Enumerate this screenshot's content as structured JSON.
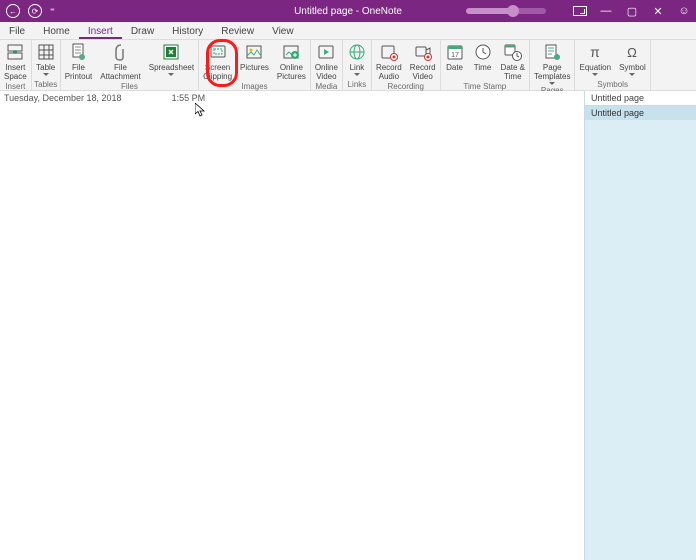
{
  "titlebar": {
    "title": "Untitled page - OneNote"
  },
  "tabs": [
    "File",
    "Home",
    "Insert",
    "Draw",
    "History",
    "Review",
    "View"
  ],
  "active_tab": 2,
  "groups": [
    {
      "label": "Insert",
      "items": [
        {
          "name": "insert-space-button",
          "label": "Insert\nSpace",
          "icon": "insert-space"
        }
      ]
    },
    {
      "label": "Tables",
      "items": [
        {
          "name": "table-button",
          "label": "Table",
          "icon": "table",
          "dd": true
        }
      ]
    },
    {
      "label": "Files",
      "items": [
        {
          "name": "file-printout-button",
          "label": "File\nPrintout",
          "icon": "file-printout"
        },
        {
          "name": "file-attachment-button",
          "label": "File\nAttachment",
          "icon": "file-attachment"
        },
        {
          "name": "spreadsheet-button",
          "label": "Spreadsheet",
          "icon": "spreadsheet",
          "dd": true
        }
      ]
    },
    {
      "label": "Images",
      "items": [
        {
          "name": "screen-clipping-button",
          "label": "Screen\nClipping",
          "icon": "screen-clipping"
        },
        {
          "name": "pictures-button",
          "label": "Pictures",
          "icon": "pictures"
        },
        {
          "name": "online-pictures-button",
          "label": "Online\nPictures",
          "icon": "online-pictures"
        }
      ]
    },
    {
      "label": "Media",
      "items": [
        {
          "name": "online-video-button",
          "label": "Online\nVideo",
          "icon": "online-video"
        }
      ]
    },
    {
      "label": "Links",
      "items": [
        {
          "name": "link-button",
          "label": "Link",
          "icon": "link",
          "dd": true
        }
      ]
    },
    {
      "label": "Recording",
      "items": [
        {
          "name": "record-audio-button",
          "label": "Record\nAudio",
          "icon": "record-audio"
        },
        {
          "name": "record-video-button",
          "label": "Record\nVideo",
          "icon": "record-video"
        }
      ]
    },
    {
      "label": "Time Stamp",
      "items": [
        {
          "name": "date-button",
          "label": "Date",
          "icon": "date"
        },
        {
          "name": "time-button",
          "label": "Time",
          "icon": "time"
        },
        {
          "name": "date-time-button",
          "label": "Date &\nTime",
          "icon": "date-time"
        }
      ]
    },
    {
      "label": "Pages",
      "items": [
        {
          "name": "page-templates-button",
          "label": "Page\nTemplates",
          "icon": "page-templates",
          "dd": true
        }
      ]
    },
    {
      "label": "Symbols",
      "items": [
        {
          "name": "equation-button",
          "label": "Equation",
          "icon": "equation",
          "dd": true
        },
        {
          "name": "symbol-button",
          "label": "Symbol",
          "icon": "symbol",
          "dd": true
        }
      ]
    }
  ],
  "page": {
    "date": "Tuesday, December 18, 2018",
    "time": "1:55 PM"
  },
  "sidepanel": {
    "header": "Untitled page",
    "items": [
      "Untitled page"
    ]
  }
}
